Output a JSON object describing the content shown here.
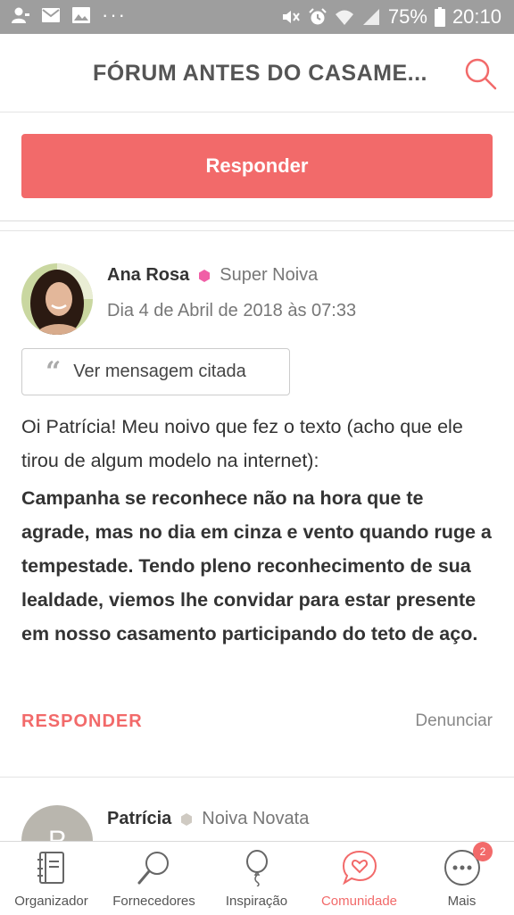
{
  "statusbar": {
    "battery": "75%",
    "time": "20:10",
    "icons": [
      "user-icon",
      "mail-icon",
      "image-icon",
      "more-dots-icon",
      "mute-icon",
      "alarm-icon",
      "wifi-icon",
      "signal-icon",
      "battery-icon"
    ]
  },
  "header": {
    "title": "FÓRUM ANTES DO CASAME...",
    "search_icon": "search-icon"
  },
  "respond_button": "Responder",
  "post": {
    "author": "Ana Rosa",
    "rank": "Super Noiva",
    "rank_color": "#f05fa6",
    "date": "Dia 4 de Abril de 2018 às 07:33",
    "quote_button": "Ver mensagem citada",
    "paragraph1": "Oi Patrícia! Meu noivo que fez o texto (acho que ele tirou de algum modelo na internet):",
    "paragraph2": "Campanha se reconhece não na hora que te agrade, mas no dia em cinza e vento quando ruge a tempestade. Tendo pleno reconhecimento de sua lealdade, viemos lhe convidar para estar presente em nosso casamento participando do teto de aço.",
    "reply": "RESPONDER",
    "report": "Denunciar"
  },
  "post2": {
    "author": "Patrícia",
    "rank": "Noiva Novata",
    "rank_color": "#cfcac2",
    "avatar_letter": "P"
  },
  "tabbar": {
    "tabs": [
      {
        "label": "Organizador",
        "icon": "notebook-icon"
      },
      {
        "label": "Fornecedores",
        "icon": "magnifier-icon"
      },
      {
        "label": "Inspiração",
        "icon": "balloon-icon"
      },
      {
        "label": "Comunidade",
        "icon": "heart-chat-icon",
        "active": true
      },
      {
        "label": "Mais",
        "icon": "more-icon",
        "badge": "2"
      }
    ]
  },
  "colors": {
    "accent": "#f26a6a",
    "statusbar": "#9e9e9e"
  }
}
